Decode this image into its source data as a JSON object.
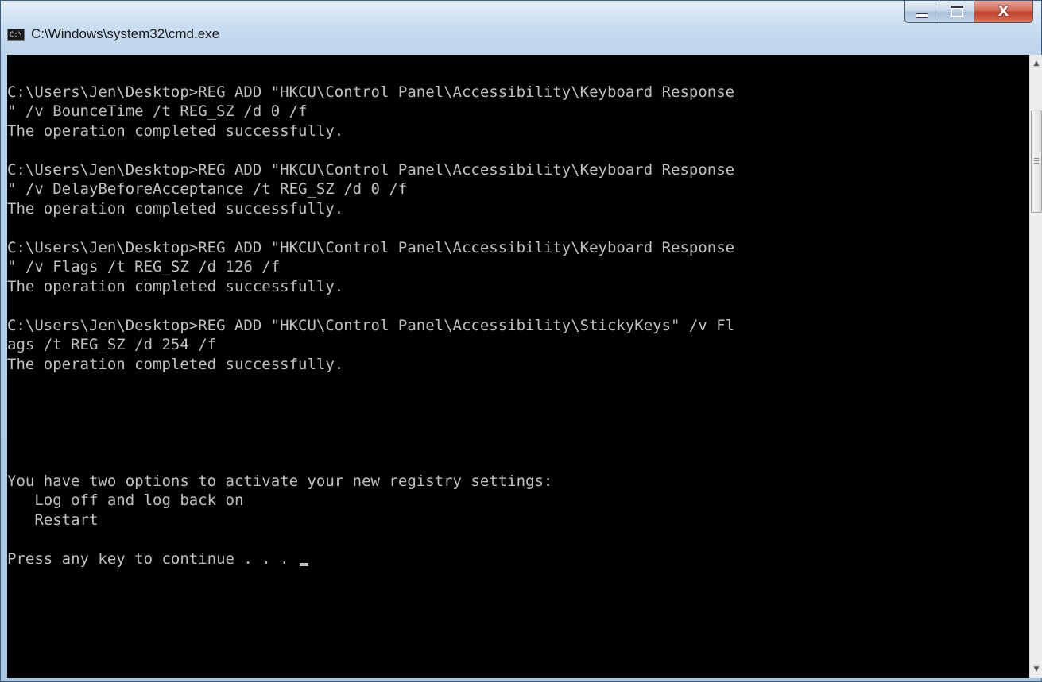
{
  "window": {
    "title": "C:\\Windows\\system32\\cmd.exe",
    "icon_label": "C:\\",
    "controls": {
      "minimize": "minimize",
      "maximize": "maximize",
      "close": "X"
    }
  },
  "console": {
    "lines": [
      "",
      "C:\\Users\\Jen\\Desktop>REG ADD \"HKCU\\Control Panel\\Accessibility\\Keyboard Response",
      "\" /v BounceTime /t REG_SZ /d 0 /f",
      "The operation completed successfully.",
      "",
      "C:\\Users\\Jen\\Desktop>REG ADD \"HKCU\\Control Panel\\Accessibility\\Keyboard Response",
      "\" /v DelayBeforeAcceptance /t REG_SZ /d 0 /f",
      "The operation completed successfully.",
      "",
      "C:\\Users\\Jen\\Desktop>REG ADD \"HKCU\\Control Panel\\Accessibility\\Keyboard Response",
      "\" /v Flags /t REG_SZ /d 126 /f",
      "The operation completed successfully.",
      "",
      "C:\\Users\\Jen\\Desktop>REG ADD \"HKCU\\Control Panel\\Accessibility\\StickyKeys\" /v Fl",
      "ags /t REG_SZ /d 254 /f",
      "The operation completed successfully.",
      "",
      "",
      "",
      "",
      "",
      "You have two options to activate your new registry settings:",
      "   Log off and log back on",
      "   Restart",
      "",
      "Press any key to continue . . . "
    ]
  },
  "colors": {
    "console_bg": "#000000",
    "console_fg": "#c0c0c0",
    "close_button": "#c0412c"
  }
}
